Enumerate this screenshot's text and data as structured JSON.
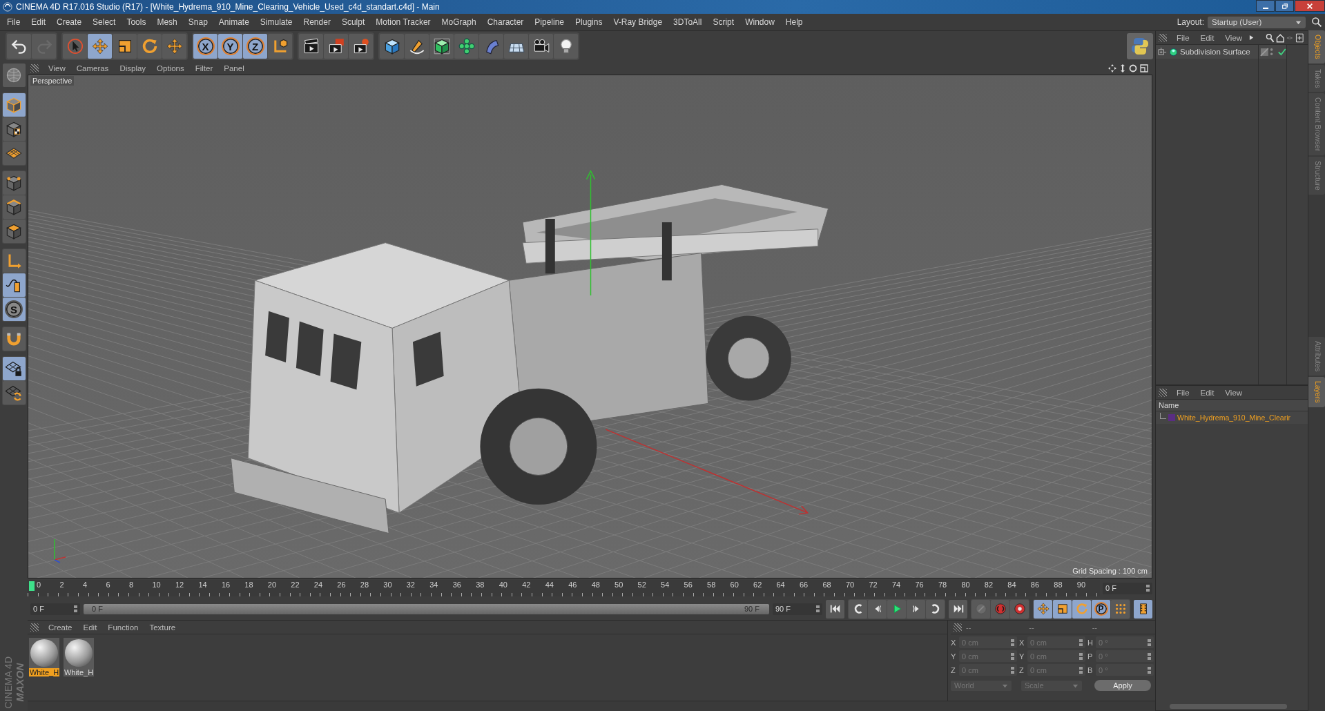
{
  "window": {
    "title": "CINEMA 4D R17.016 Studio (R17) - [White_Hydrema_910_Mine_Clearing_Vehicle_Used_c4d_standart.c4d] - Main"
  },
  "menu": [
    "File",
    "Edit",
    "Create",
    "Select",
    "Tools",
    "Mesh",
    "Snap",
    "Animate",
    "Simulate",
    "Render",
    "Sculpt",
    "Motion Tracker",
    "MoGraph",
    "Character",
    "Pipeline",
    "Plugins",
    "V-Ray Bridge",
    "3DToAll",
    "Script",
    "Window",
    "Help"
  ],
  "layout": {
    "label": "Layout:",
    "value": "Startup (User)"
  },
  "toolbar": [
    [
      {
        "selected": false
      },
      {
        "selected": false
      }
    ],
    [
      {
        "selected": false
      },
      {
        "selected": true
      },
      {
        "selected": false
      },
      {
        "selected": false
      },
      {
        "selected": false
      }
    ],
    [
      {
        "label": "X",
        "selected": true
      },
      {
        "label": "Y",
        "selected": true
      },
      {
        "label": "Z",
        "selected": true
      },
      {
        "selected": false
      }
    ],
    [
      {
        "selected": false
      },
      {
        "selected": false
      },
      {
        "selected": false
      }
    ],
    [
      {
        "selected": false
      },
      {
        "selected": false
      },
      {
        "selected": false
      },
      {
        "selected": false
      },
      {
        "selected": false
      },
      {
        "selected": false
      },
      {
        "selected": false
      },
      {
        "selected": false
      }
    ]
  ],
  "tools": [
    [
      {
        "selected": false
      }
    ],
    [
      {
        "selected": true
      },
      {
        "selected": false
      },
      {
        "selected": false
      }
    ],
    [
      {
        "selected": false
      },
      {
        "selected": false
      },
      {
        "selected": false
      }
    ],
    [
      {
        "selected": false
      },
      {
        "selected": true
      },
      {
        "label": "S",
        "selected": true
      }
    ],
    [
      {
        "selected": false
      }
    ],
    [
      {
        "selected": true
      },
      {
        "selected": false
      }
    ]
  ],
  "viewport": {
    "menu": [
      "View",
      "Cameras",
      "Display",
      "Options",
      "Filter",
      "Panel"
    ],
    "camera": "Perspective",
    "grid_spacing": "Grid Spacing : 100 cm"
  },
  "timeline": {
    "ticks": [
      "0",
      "2",
      "4",
      "6",
      "8",
      "10",
      "12",
      "14",
      "16",
      "18",
      "20",
      "22",
      "24",
      "26",
      "28",
      "30",
      "32",
      "34",
      "36",
      "38",
      "40",
      "42",
      "44",
      "46",
      "48",
      "50",
      "52",
      "54",
      "56",
      "58",
      "60",
      "62",
      "64",
      "66",
      "68",
      "70",
      "72",
      "74",
      "76",
      "78",
      "80",
      "82",
      "84",
      "86",
      "88",
      "90"
    ],
    "current": "0 F",
    "start": "0 F",
    "range": {
      "start": "0 F",
      "end": "90 F",
      "level": 1
    },
    "end": "90 F"
  },
  "transport": [
    [
      {
        "selected": false
      }
    ],
    [
      {
        "selected": false
      },
      {
        "selected": false
      },
      {
        "selected": false
      },
      {
        "selected": false
      },
      {
        "selected": false
      }
    ],
    [
      {
        "selected": false
      }
    ],
    [
      {
        "selected": false
      },
      {
        "selected": false
      },
      {
        "selected": false
      }
    ],
    [
      {
        "selected": true
      },
      {
        "selected": true
      },
      {
        "selected": true
      },
      {
        "label": "P",
        "selected": true
      },
      {
        "selected": false
      }
    ],
    [
      {
        "selected": true
      }
    ]
  ],
  "materials": {
    "menu": [
      "Create",
      "Edit",
      "Function",
      "Texture"
    ],
    "items": [
      {
        "name": "White_H",
        "selected": true
      },
      {
        "name": "White_H",
        "selected": false
      }
    ]
  },
  "coordinates": {
    "disabled": true,
    "headers": [
      "--",
      "--",
      "--"
    ],
    "rows": [
      {
        "cells": [
          {
            "axis": "X",
            "value": "0 cm"
          },
          {
            "axis": "X",
            "value": "0 cm"
          },
          {
            "axis": "H",
            "value": "0 °"
          }
        ]
      },
      {
        "cells": [
          {
            "axis": "Y",
            "value": "0 cm"
          },
          {
            "axis": "Y",
            "value": "0 cm"
          },
          {
            "axis": "P",
            "value": "0 °"
          }
        ]
      },
      {
        "cells": [
          {
            "axis": "Z",
            "value": "0 cm"
          },
          {
            "axis": "Z",
            "value": "0 cm"
          },
          {
            "axis": "B",
            "value": "0 °"
          }
        ]
      }
    ],
    "dropdowns": [
      "World",
      "Scale"
    ],
    "apply": "Apply"
  },
  "objects": {
    "menu": [
      "File",
      "Edit",
      "View"
    ],
    "items": [
      {
        "name": "Subdivision Surface",
        "enabled": true
      }
    ]
  },
  "layers": {
    "menu": [
      "File",
      "Edit",
      "View"
    ],
    "column": "Name",
    "items": [
      {
        "name": "White_Hydrema_910_Mine_Clearir",
        "color": "#5a2d82"
      }
    ]
  },
  "side_tabs": [
    {
      "label": "Objects",
      "selected": true
    },
    {
      "label": "Takes",
      "selected": false
    },
    {
      "label": "Content Browser",
      "selected": false
    },
    {
      "label": "Structure",
      "selected": false
    }
  ],
  "lower_tabs": [
    {
      "label": "Attributes",
      "selected": false
    },
    {
      "label": "Layers",
      "selected": true
    }
  ],
  "logo": {
    "brand": "MAXON",
    "product": "CINEMA 4D"
  }
}
